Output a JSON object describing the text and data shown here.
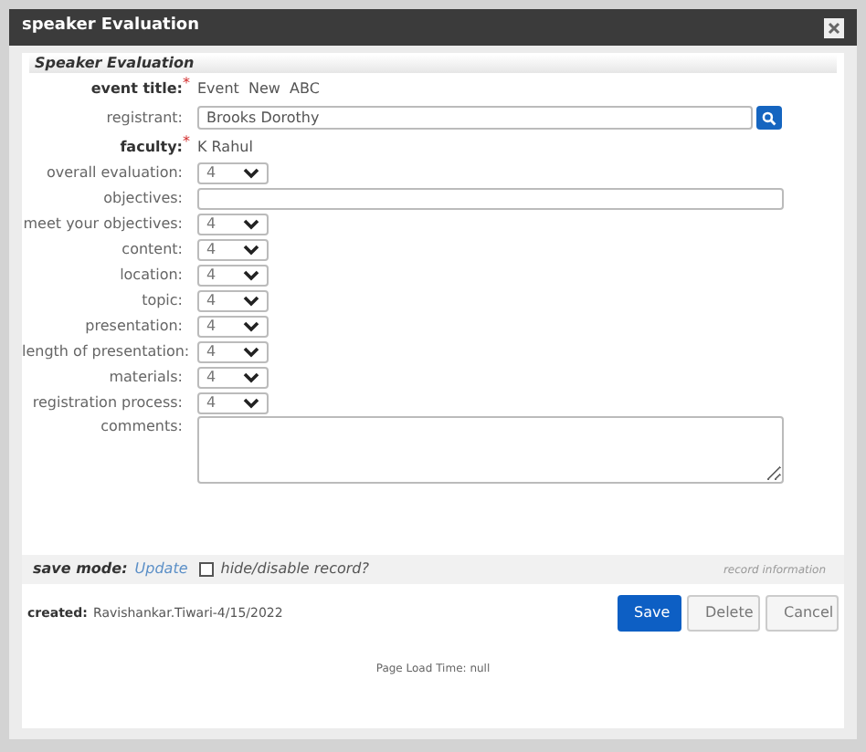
{
  "window": {
    "title": "speaker Evaluation"
  },
  "section": {
    "title": "Speaker Evaluation"
  },
  "fields": [
    {
      "kind": "text",
      "label": "event title:",
      "required_mark": "*",
      "value": "Event  New  ABC"
    },
    {
      "kind": "lookup",
      "label": "registrant:",
      "value": "Brooks Dorothy"
    },
    {
      "kind": "text",
      "label": "faculty:",
      "required_mark": "*",
      "value": "K Rahul"
    },
    {
      "kind": "select",
      "label": "overall evaluation:",
      "value": "4"
    },
    {
      "kind": "input",
      "label": "objectives:"
    },
    {
      "kind": "select",
      "label": "meet your objectives:",
      "value": "4"
    },
    {
      "kind": "select",
      "label": "content:",
      "value": "4"
    },
    {
      "kind": "select",
      "label": "location:",
      "value": "4"
    },
    {
      "kind": "select",
      "label": "topic:",
      "value": "4"
    },
    {
      "kind": "select",
      "label": "presentation:",
      "value": "4"
    },
    {
      "kind": "select",
      "label": "length of presentation:",
      "value": "4"
    },
    {
      "kind": "select",
      "label": "materials:",
      "value": "4"
    },
    {
      "kind": "select",
      "label": "registration process:",
      "value": "4"
    },
    {
      "kind": "textarea",
      "label": "comments:"
    }
  ],
  "save_bar": {
    "label": "save mode:",
    "mode": "Update",
    "checkbox": {
      "label": "hide/disable record?",
      "checked": false
    },
    "info_link": "record information"
  },
  "created": {
    "label": "created:",
    "value": "Ravishankar.Tiwari-4/15/2022"
  },
  "buttons": [
    {
      "label": "Save",
      "kind": "primary"
    },
    {
      "label": "Delete",
      "kind": "default"
    },
    {
      "label": "Cancel",
      "kind": "default"
    }
  ],
  "footer": "Page Load Time: null"
}
